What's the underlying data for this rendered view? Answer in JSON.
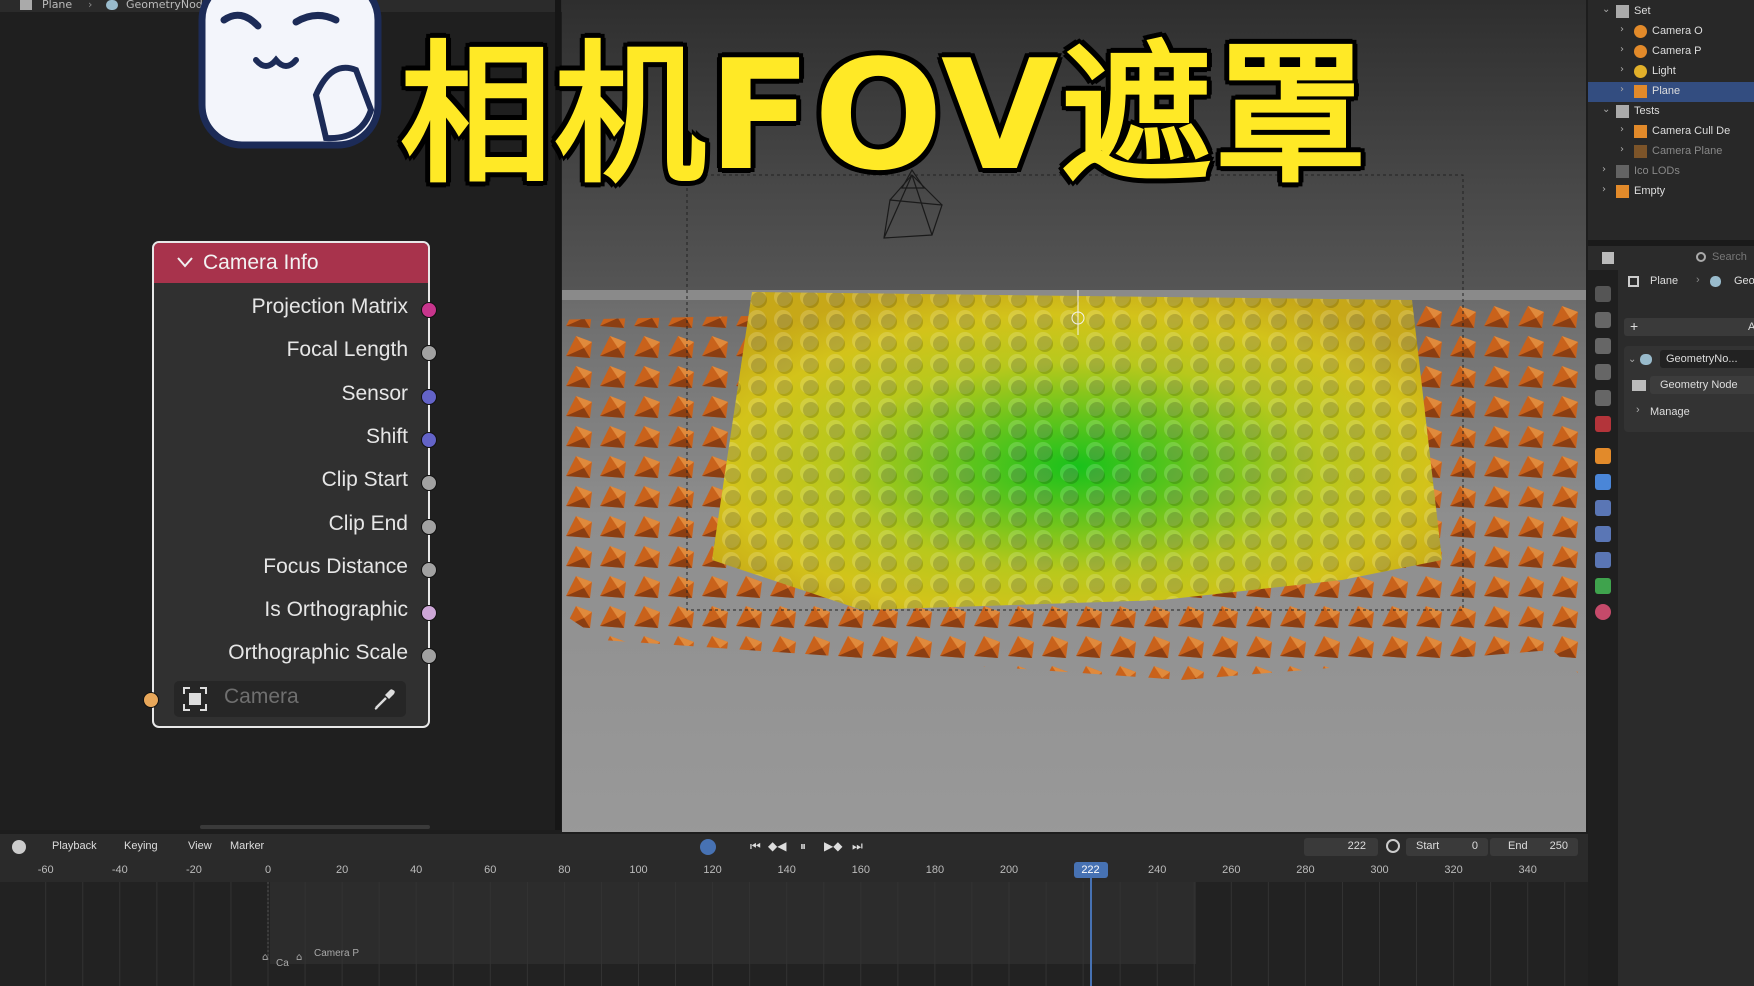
{
  "node_editor": {
    "breadcrumb": [
      "Plane",
      "GeometryNodes"
    ]
  },
  "node": {
    "title": "Camera Info",
    "outputs": [
      {
        "label": "Projection Matrix",
        "color": "#c7358c"
      },
      {
        "label": "Focal Length",
        "color": "#a1a1a1"
      },
      {
        "label": "Sensor",
        "color": "#6363c7"
      },
      {
        "label": "Shift",
        "color": "#6363c7"
      },
      {
        "label": "Clip Start",
        "color": "#a1a1a1"
      },
      {
        "label": "Clip End",
        "color": "#a1a1a1"
      },
      {
        "label": "Focus Distance",
        "color": "#a1a1a1"
      },
      {
        "label": "Is Orthographic",
        "color": "#cca6d6"
      },
      {
        "label": "Orthographic Scale",
        "color": "#a1a1a1"
      }
    ],
    "camera_field": {
      "placeholder": "Camera",
      "icon": "camera-object-icon",
      "eyedropper": "eyedropper-icon"
    }
  },
  "overlay_title": "相机FOV遮罩",
  "outliner": {
    "items": [
      {
        "label": "Set",
        "indent": 0,
        "type": "collection"
      },
      {
        "label": "Camera O",
        "indent": 1,
        "type": "camera"
      },
      {
        "label": "Camera P",
        "indent": 1,
        "type": "camera"
      },
      {
        "label": "Light",
        "indent": 1,
        "type": "light"
      },
      {
        "label": "Plane",
        "indent": 1,
        "type": "mesh",
        "selected": true
      },
      {
        "label": "Tests",
        "indent": 0,
        "type": "collection"
      },
      {
        "label": "Camera Cull De",
        "indent": 1,
        "type": "mesh"
      },
      {
        "label": "Camera Plane",
        "indent": 1,
        "type": "mesh",
        "dim": true
      },
      {
        "label": "Ico LODs",
        "indent": 0,
        "type": "collection",
        "dim": true
      },
      {
        "label": "Empty",
        "indent": 0,
        "type": "empty"
      }
    ]
  },
  "properties": {
    "search_placeholder": "Search",
    "breadcrumb": [
      "Plane",
      "Geo"
    ],
    "add_label": "Ac",
    "modifier_name": "GeometryNo...",
    "node_group": "Geometry Node",
    "manage": "Manage"
  },
  "timeline": {
    "menus": [
      "Playback",
      "Keying",
      "View",
      "Marker"
    ],
    "current_frame": "222",
    "start_label": "Start",
    "start_value": "0",
    "end_label": "End",
    "end_value": "250",
    "ruler": [
      "-60",
      "-40",
      "-20",
      "0",
      "20",
      "40",
      "60",
      "80",
      "100",
      "120",
      "140",
      "160",
      "180",
      "200",
      "222",
      "240",
      "260",
      "280",
      "300",
      "320",
      "340"
    ],
    "marker_labels": [
      "Ca",
      "Camera P"
    ]
  },
  "colors": {
    "node_header": "#a8334c",
    "title_yellow": "#ffe926",
    "selection_blue": "#334d80",
    "playhead": "#4772b3"
  }
}
